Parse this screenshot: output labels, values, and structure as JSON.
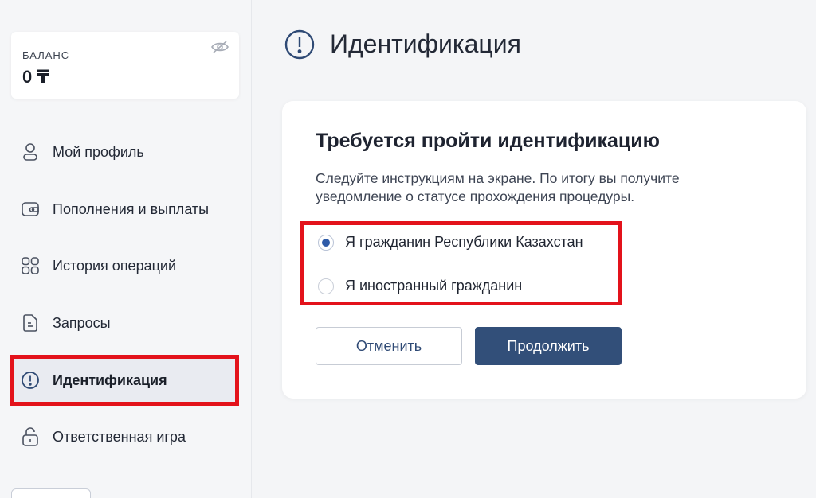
{
  "balance": {
    "label": "БАЛАНС",
    "value": "0 ₸",
    "visibility_icon": "eye-off-icon"
  },
  "sidebar": {
    "items": [
      {
        "label": "Мой профиль",
        "icon": "user-icon",
        "active": false
      },
      {
        "label": "Пополнения и выплаты",
        "icon": "wallet-icon",
        "active": false
      },
      {
        "label": "История операций",
        "icon": "grid-icon",
        "active": false
      },
      {
        "label": "Запросы",
        "icon": "document-icon",
        "active": false
      },
      {
        "label": "Идентификация",
        "icon": "exclamation-circle-icon",
        "active": true
      },
      {
        "label": "Ответственная игра",
        "icon": "lock-icon",
        "active": false
      }
    ]
  },
  "header": {
    "title": "Идентификация",
    "icon": "exclamation-circle-icon"
  },
  "card": {
    "title": "Требуется пройти идентификацию",
    "description": "Следуйте инструкциям на экране. По итогу вы получите уведомление о статусе прохождения процедуры.",
    "options": [
      {
        "label": "Я гражданин Республики Казахстан",
        "selected": true
      },
      {
        "label": "Я иностранный гражданин",
        "selected": false
      }
    ],
    "cancel_label": "Отменить",
    "continue_label": "Продолжить"
  },
  "colors": {
    "accent": "#324f79",
    "radio_selected": "#2e5ba8",
    "highlight_border": "#e3121b"
  }
}
